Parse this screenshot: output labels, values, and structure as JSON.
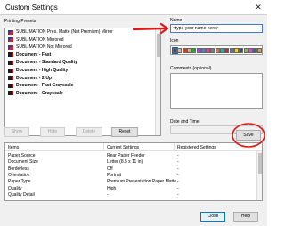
{
  "window": {
    "title": "Custom Settings",
    "close_glyph": "✕"
  },
  "presets": {
    "label": "Printing Presets",
    "items": [
      {
        "label": "SUBLIMATION Pres. Matte (Not Premium) Mirror",
        "icon": "sublimation-icon",
        "bold": false
      },
      {
        "label": "SUBLIMATION Mirrored",
        "icon": "sublimation-icon",
        "bold": false
      },
      {
        "label": "SUBLIMATION Not Mirrored",
        "icon": "sublimation-icon",
        "bold": false
      },
      {
        "label": "Document - Fast",
        "icon": "document-icon",
        "bold": true
      },
      {
        "label": "Document - Standard Quality",
        "icon": "document-icon",
        "bold": true
      },
      {
        "label": "Document - High Quality",
        "icon": "document-icon",
        "bold": true
      },
      {
        "label": "Document - 2-Up",
        "icon": "document-icon",
        "bold": true
      },
      {
        "label": "Document - Fast Grayscale",
        "icon": "document-icon",
        "bold": true
      },
      {
        "label": "Document - Grayscale",
        "icon": "document-icon",
        "bold": true
      }
    ]
  },
  "preset_buttons": {
    "show": "Show",
    "hide": "Hide",
    "delete": "Delete",
    "reset": "Reset"
  },
  "name": {
    "label": "Name",
    "value": "<type your name here>"
  },
  "icon": {
    "label": "Icon",
    "swatches": [
      "#2a4fb0",
      "#c0c0c0",
      "#d93a2b",
      "#e8b13a",
      "#3a9d3a",
      "#9b4fd1",
      "#2f8fd6",
      "#d64f8f",
      "#7a7a7a",
      "#e0722b",
      "#3aa6a0",
      "#b8322b",
      "#5a6fd0",
      "#f0d030",
      "#4a4a4a",
      "#8ab83a",
      "#c05ad0",
      "#2a6a8a",
      "#d09a5a"
    ]
  },
  "comments": {
    "label": "Comments (optional)"
  },
  "datetime": {
    "label": "Date and Time"
  },
  "save_button": "Save",
  "table": {
    "headers": [
      "Items",
      "Current Settings",
      "Registered Settings"
    ],
    "rows": [
      [
        "Paper Source",
        "Rear Paper Feeder",
        "-"
      ],
      [
        "Document Size",
        "Letter (8.5 x 11 in)",
        "-"
      ],
      [
        "Borderless",
        "Off",
        "-"
      ],
      [
        "Orientation",
        "Portrait",
        "-"
      ],
      [
        "Paper Type",
        "Premium Presentation Paper Matte",
        "-"
      ],
      [
        "Quality",
        "High",
        "-"
      ],
      [
        "Quality Detail",
        "-",
        "-"
      ]
    ]
  },
  "footer": {
    "close": "Close",
    "help": "Help"
  },
  "colors": {
    "annotation_red": "#e01818",
    "accent": "#0078d7"
  }
}
